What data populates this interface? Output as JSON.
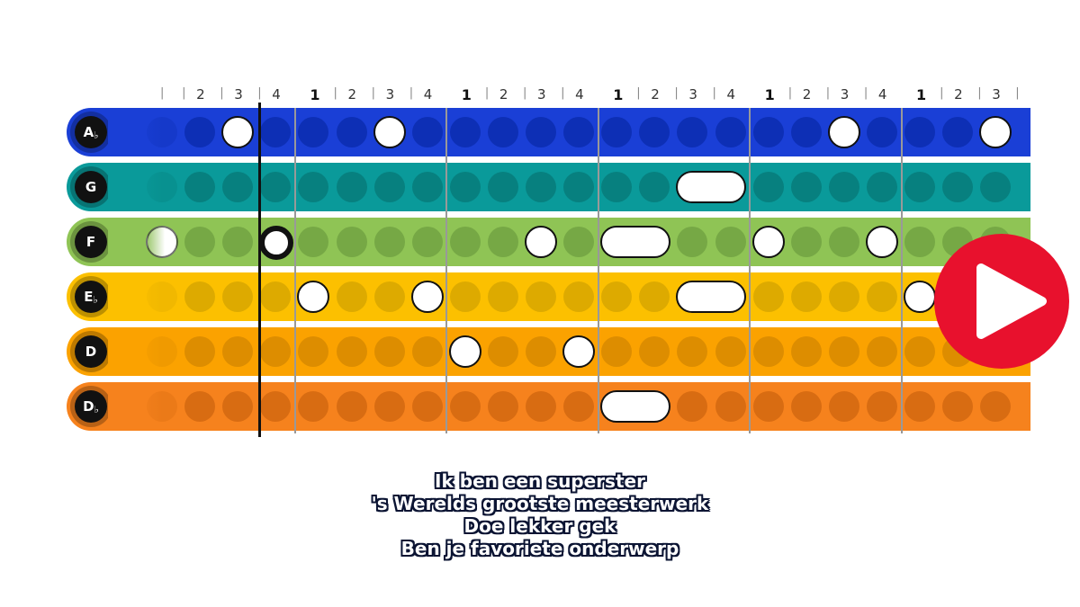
{
  "ruler": {
    "measures": 6,
    "beat_labels": [
      "1",
      "2",
      "3",
      "4"
    ]
  },
  "lanes": [
    {
      "label": "A",
      "accidental": "♭",
      "color": "#1a3fd6",
      "dot_color": "#0d2fb5"
    },
    {
      "label": "G",
      "accidental": "",
      "color": "#0a9a9a",
      "dot_color": "#07807f"
    },
    {
      "label": "F",
      "accidental": "",
      "color": "#8fc455",
      "dot_color": "#76a845"
    },
    {
      "label": "E",
      "accidental": "♭",
      "color": "#fcc000",
      "dot_color": "#ddaa00"
    },
    {
      "label": "D",
      "accidental": "",
      "color": "#fba200",
      "dot_color": "#dd8d00"
    },
    {
      "label": "D",
      "accidental": "♭",
      "color": "#f6821d",
      "dot_color": "#d86c12"
    }
  ],
  "notes": [
    {
      "lane": 0,
      "beat": 2,
      "length": 1
    },
    {
      "lane": 0,
      "beat": 6,
      "length": 1
    },
    {
      "lane": 0,
      "beat": 18,
      "length": 1
    },
    {
      "lane": 0,
      "beat": 22,
      "length": 1
    },
    {
      "lane": 1,
      "beat": 14,
      "length": 2
    },
    {
      "lane": 2,
      "beat": 0,
      "length": 1
    },
    {
      "lane": 2,
      "beat": 10,
      "length": 1
    },
    {
      "lane": 2,
      "beat": 12,
      "length": 2
    },
    {
      "lane": 2,
      "beat": 16,
      "length": 1
    },
    {
      "lane": 2,
      "beat": 19,
      "length": 1
    },
    {
      "lane": 3,
      "beat": 4,
      "length": 1
    },
    {
      "lane": 3,
      "beat": 7,
      "length": 1
    },
    {
      "lane": 3,
      "beat": 14,
      "length": 2
    },
    {
      "lane": 3,
      "beat": 20,
      "length": 1
    },
    {
      "lane": 4,
      "beat": 8,
      "length": 1
    },
    {
      "lane": 4,
      "beat": 11,
      "length": 1
    },
    {
      "lane": 5,
      "beat": 12,
      "length": 2
    }
  ],
  "playhead": {
    "active_lane": 2
  },
  "play_button": {
    "icon": "play-icon",
    "color": "#e8112d"
  },
  "lyrics": {
    "line1": "Ik ben een superster",
    "line2": "'s Werelds grootste meesterwerk",
    "line3": "Doe lekker gek",
    "line4": "Ben je favoriete onderwerp"
  }
}
